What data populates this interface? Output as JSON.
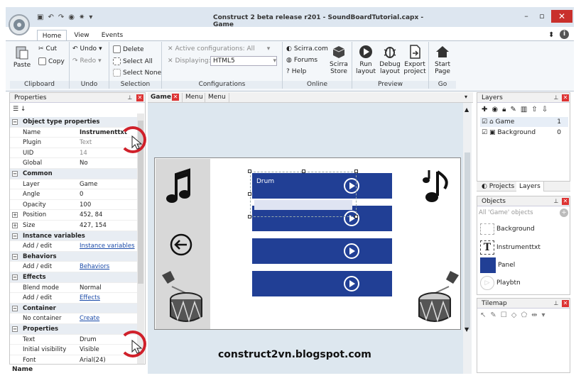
{
  "app": {
    "title": "Construct 2 beta release r201 - SoundBoardTutorial.capx - Game",
    "window_controls": [
      "–",
      "▫",
      "✕"
    ]
  },
  "ribbon_tabs": [
    "Home",
    "View",
    "Events"
  ],
  "ribbon": {
    "clipboard": {
      "label": "Clipboard",
      "paste": "Paste",
      "cut": "Cut",
      "copy": "Copy"
    },
    "undo": {
      "label": "Undo",
      "undo": "Undo",
      "redo": "Redo"
    },
    "selection": {
      "label": "Selection",
      "delete": "Delete",
      "select_all": "Select All",
      "select_none": "Select None"
    },
    "configurations": {
      "label": "Configurations",
      "active": "Active configurations: All",
      "displaying": "Displaying:",
      "displaying_value": "HTML5"
    },
    "online": {
      "label": "Online",
      "scirra": "Scirra.com",
      "forums": "Forums",
      "help": "Help",
      "store_l1": "Scirra",
      "store_l2": "Store"
    },
    "preview": {
      "label": "Preview",
      "run_l1": "Run",
      "run_l2": "layout",
      "debug_l1": "Debug",
      "debug_l2": "layout",
      "export_l1": "Export",
      "export_l2": "project"
    },
    "go": {
      "label": "Go",
      "start_l1": "Start",
      "start_l2": "Page"
    }
  },
  "properties": {
    "title": "Properties",
    "footer": "Name",
    "rows": [
      {
        "type": "cat",
        "k": "Object type properties"
      },
      {
        "type": "row",
        "k": "Name",
        "v": "Instrumenttxt",
        "bold": true
      },
      {
        "type": "row",
        "k": "Plugin",
        "v": "Text",
        "dim": true
      },
      {
        "type": "row",
        "k": "UID",
        "v": "14",
        "dim": true
      },
      {
        "type": "row",
        "k": "Global",
        "v": "No"
      },
      {
        "type": "cat",
        "k": "Common"
      },
      {
        "type": "row",
        "k": "Layer",
        "v": "Game"
      },
      {
        "type": "row",
        "k": "Angle",
        "v": "0"
      },
      {
        "type": "row",
        "k": "Opacity",
        "v": "100"
      },
      {
        "type": "row",
        "k": "Position",
        "v": "452, 84",
        "plus": true
      },
      {
        "type": "row",
        "k": "Size",
        "v": "427, 154",
        "plus": true
      },
      {
        "type": "cat",
        "k": "Instance variables"
      },
      {
        "type": "row",
        "k": "Add / edit",
        "v": "Instance variables",
        "link": true
      },
      {
        "type": "cat",
        "k": "Behaviors"
      },
      {
        "type": "row",
        "k": "Add / edit",
        "v": "Behaviors",
        "link": true
      },
      {
        "type": "cat",
        "k": "Effects"
      },
      {
        "type": "row",
        "k": "Blend mode",
        "v": "Normal"
      },
      {
        "type": "row",
        "k": "Add / edit",
        "v": "Effects",
        "link": true
      },
      {
        "type": "cat",
        "k": "Container"
      },
      {
        "type": "row",
        "k": "No container",
        "v": "Create",
        "link": true
      },
      {
        "type": "cat",
        "k": "Properties"
      },
      {
        "type": "row",
        "k": "Text",
        "v": "Drum"
      },
      {
        "type": "row",
        "k": "Initial visibility",
        "v": "Visible"
      },
      {
        "type": "row",
        "k": "Font",
        "v": "Arial(24)"
      }
    ]
  },
  "editor_tabs": [
    "Game",
    "Menu",
    "Menu"
  ],
  "canvas": {
    "drum_text": "Drum"
  },
  "layers": {
    "title": "Layers",
    "items": [
      {
        "name": "Game",
        "index": "1"
      },
      {
        "name": "Background",
        "index": "0"
      }
    ]
  },
  "project_tabs": [
    "Projects",
    "Layers"
  ],
  "objects": {
    "title": "Objects",
    "filter": "All 'Game' objects",
    "items": [
      "Background",
      "Instrumenttxt",
      "Panel",
      "Playbtn"
    ]
  },
  "tilemap": {
    "title": "Tilemap"
  },
  "watermark": "construct2vn.blogspot.com",
  "colors": {
    "panel_blue": "#213f95",
    "accent_red": "#d0202a"
  }
}
